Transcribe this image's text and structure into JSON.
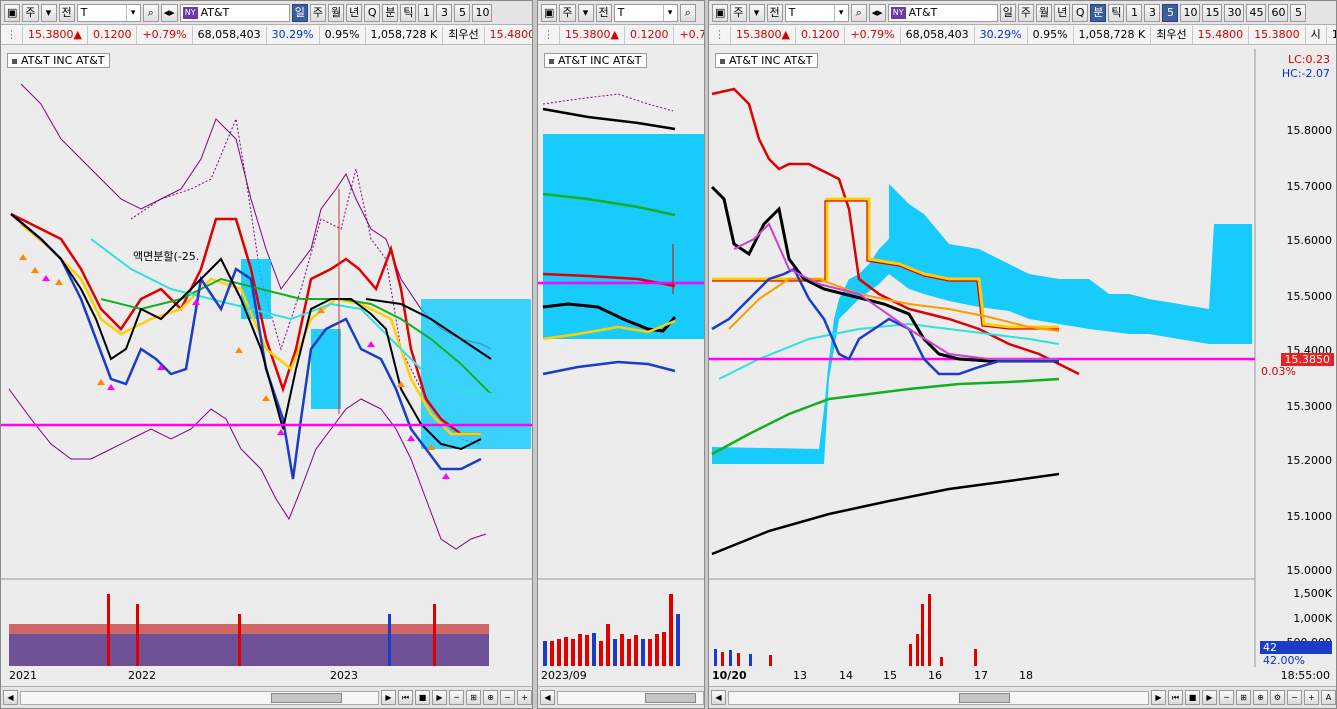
{
  "quote": {
    "price": "15.3800",
    "change": "0.1200",
    "change_pct": "+0.79%",
    "volume": "68,058,403",
    "vol_ratio": "30.29%",
    "turnover_pct": "0.95%",
    "prev_volume": "1,058,728 K",
    "best_label": "최우선",
    "best_price": "15.4800",
    "last_price": "15.3800",
    "extra_label": "시",
    "extra_value": "1"
  },
  "toolbar": {
    "btn_ju": "주",
    "btn_jeon": "전",
    "symbol": "T",
    "exchange": "NY",
    "name": "AT&T",
    "periods": [
      "일",
      "주",
      "월",
      "년",
      "Q"
    ],
    "minute_label": "분",
    "tick_label": "틱",
    "intervals_left": [
      "1",
      "3",
      "5",
      "10"
    ],
    "intervals_right": [
      "1",
      "3",
      "5",
      "10",
      "15",
      "30",
      "45",
      "60",
      "5"
    ]
  },
  "panels": {
    "left": {
      "title": "AT&T INC  AT&T",
      "annotation": "액면분할(-25.",
      "x_labels": [
        "2021",
        "2022",
        "2023"
      ]
    },
    "middle": {
      "title": "AT&T INC  AT&T",
      "x_labels": [
        "2023/09"
      ]
    },
    "right": {
      "title": "AT&T INC  AT&T",
      "lc": "LC:0.23",
      "hc": "HC:-2.07",
      "y_labels": [
        "15.8000",
        "15.7000",
        "15.6000",
        "15.5000",
        "15.4000",
        "15.3000",
        "15.2000",
        "15.1000",
        "15.0000"
      ],
      "price_tag": "15.3850",
      "price_pct": "0.03%",
      "vol_labels": [
        "1,500K",
        "1,000K",
        "500,000"
      ],
      "vol_tag": "42",
      "vol_pct": "42.00%",
      "x_labels": [
        "10/20",
        "13",
        "14",
        "15",
        "16",
        "17",
        "18"
      ],
      "clock": "18:55:00"
    }
  },
  "colors": {
    "ichimoku_cloud": "#00c8ff",
    "horizontal_line": "#ff00ff",
    "up_candle": "#e00000",
    "down_candle": "#1a3cc8"
  }
}
